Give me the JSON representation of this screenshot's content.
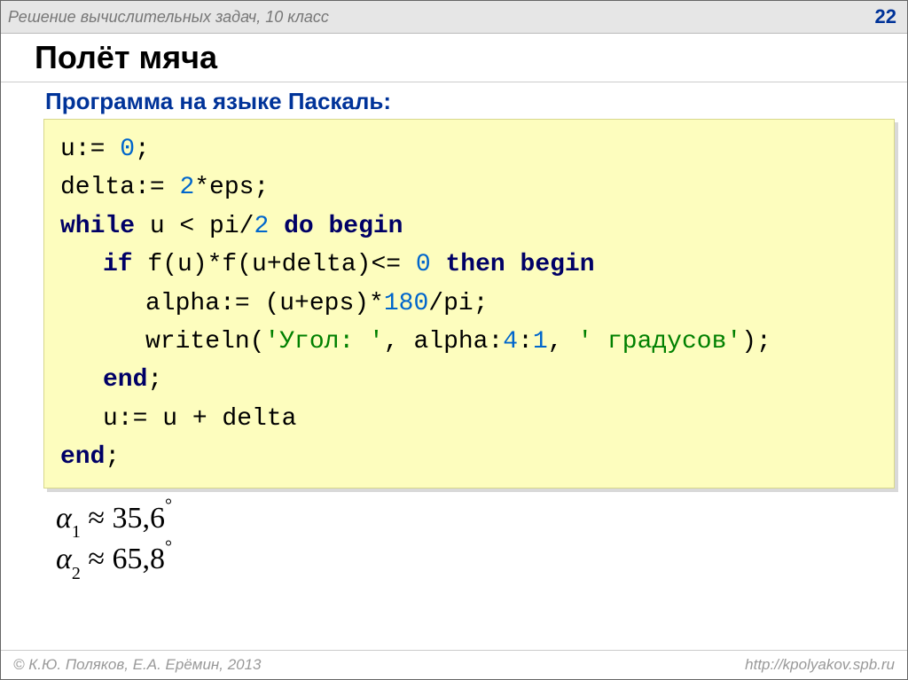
{
  "header": {
    "breadcrumb": "Решение  вычислительных задач, 10 класс",
    "page": "22"
  },
  "title": "Полёт мяча",
  "subtitle": "Программа на языке Паскаль:",
  "code": {
    "l1a": "u:=",
    "l1n": "0",
    "l1b": ";",
    "l2a": "delta:=",
    "l2n": "2",
    "l2b": "*eps;",
    "l3a": "while",
    "l3b": " u < pi/",
    "l3n": "2",
    "l3c": " ",
    "l3d": "do begin",
    "l4a": "if",
    "l4b": " f(u)*f(u+delta)",
    "l4c": "<=",
    "l4n": "0",
    "l4d": " ",
    "l4e": "then begin",
    "l5a": "alpha:=",
    "l5b": "(u+eps)*",
    "l5n": "180",
    "l5c": "/pi;",
    "l6a": "writeln(",
    "l6s1": "'Угол: '",
    "l6b": ",",
    "l6c": "alpha:",
    "l6n1": "4",
    "l6d": ":",
    "l6n2": "1",
    "l6e": ",",
    "l6s2": "' градусов'",
    "l6f": ");",
    "l7": "end",
    "l7b": ";",
    "l8": "u:= u + delta",
    "l9": "end",
    "l9b": ";"
  },
  "results": {
    "a1": {
      "sym": "α",
      "sub": "1",
      "approx": "≈",
      "val": "35,6",
      "deg": "°"
    },
    "a2": {
      "sym": "α",
      "sub": "2",
      "approx": "≈",
      "val": "65,8",
      "deg": "°"
    }
  },
  "footer": {
    "left": "© К.Ю. Поляков, Е.А. Ерёмин, 2013",
    "right": "http://kpolyakov.spb.ru"
  }
}
